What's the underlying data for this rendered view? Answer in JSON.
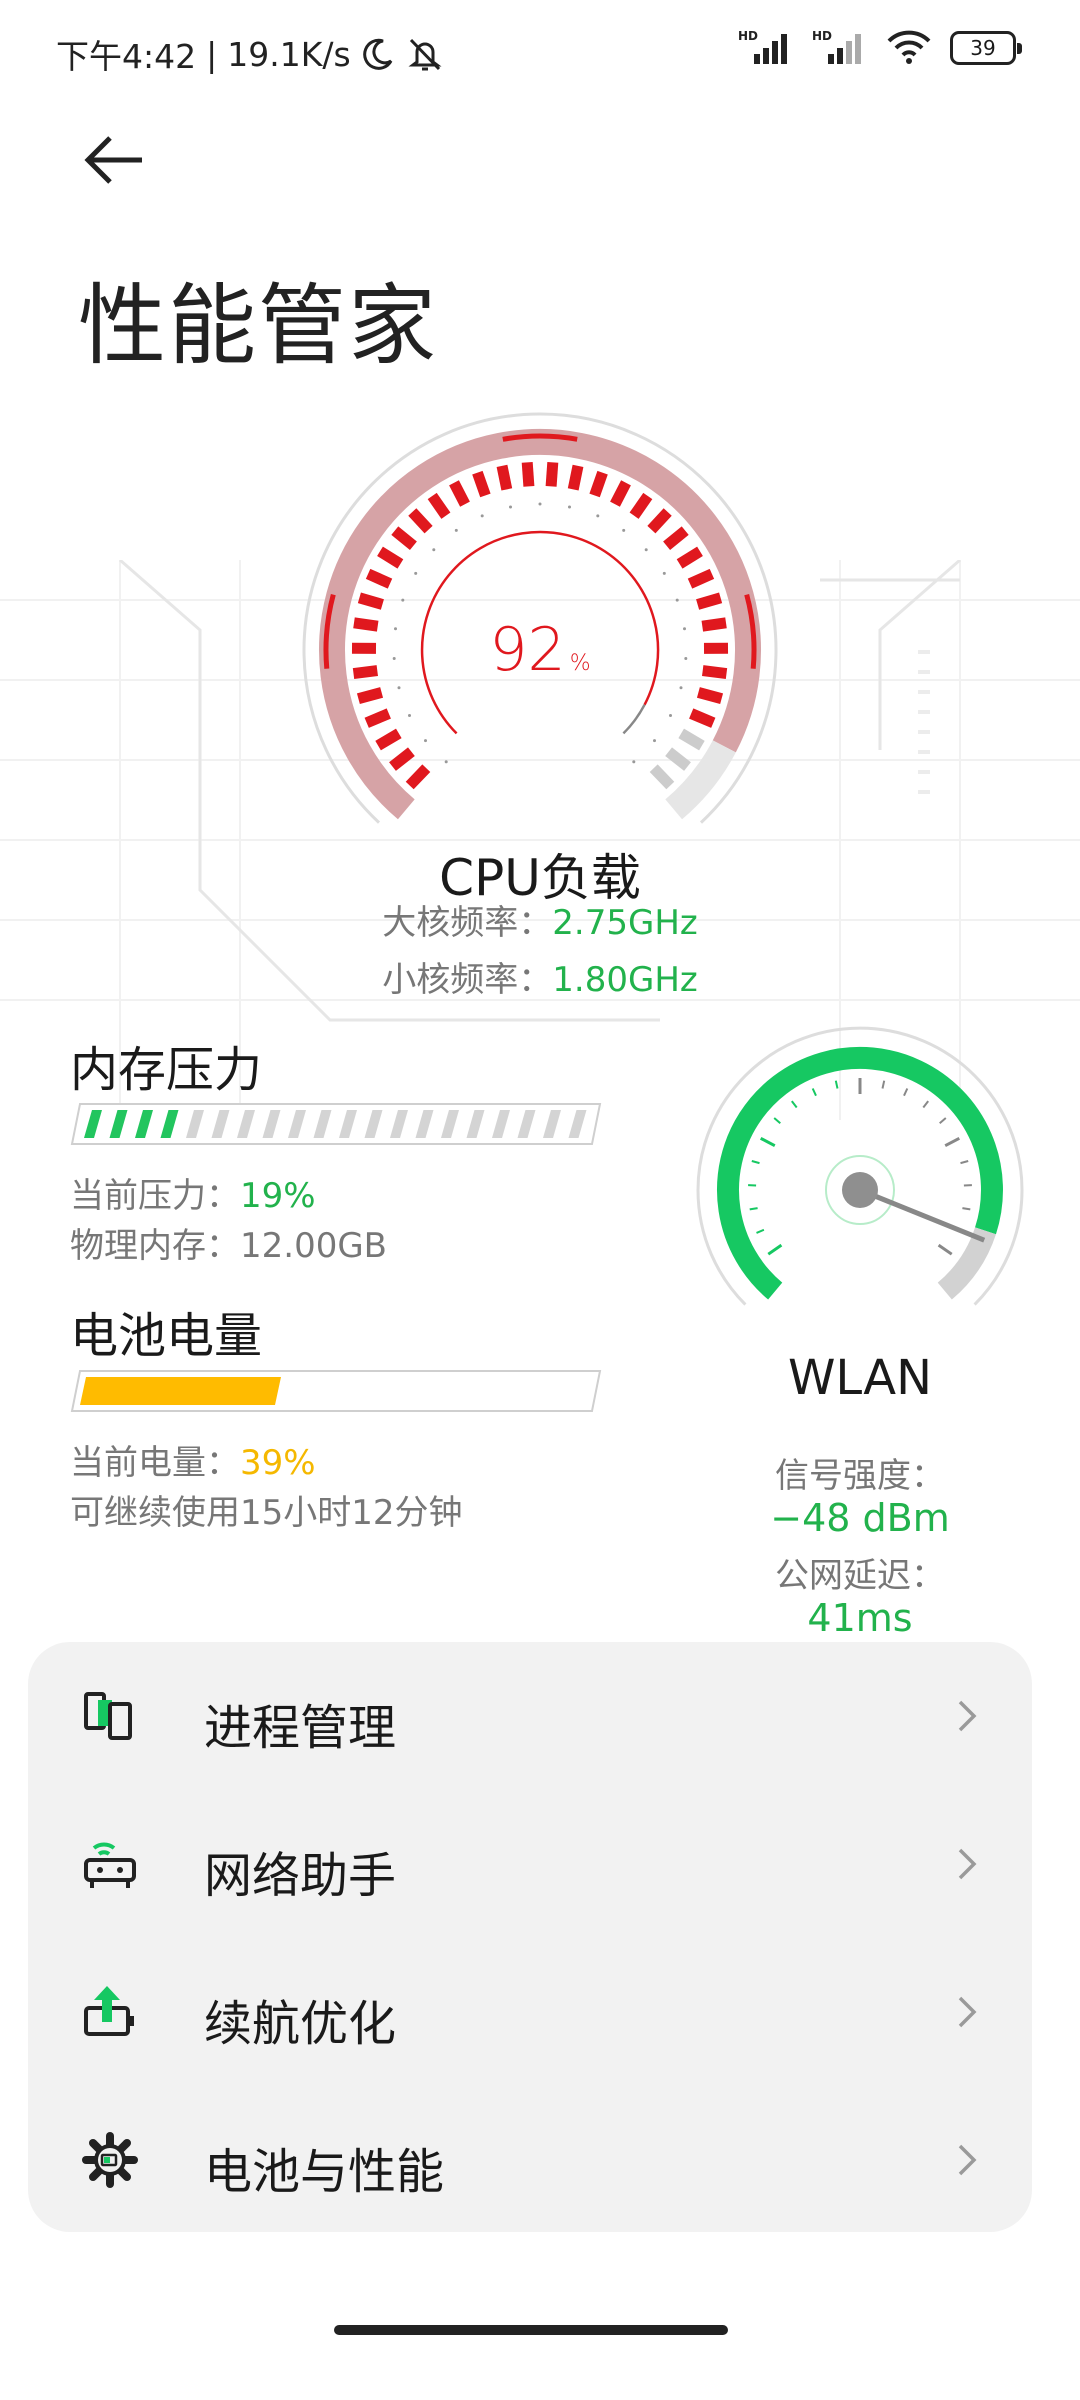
{
  "status_bar": {
    "time": "下午4:42",
    "net_speed": "19.1K/s",
    "hd1": "HD",
    "hd2": "HD",
    "battery": "39",
    "icons": [
      "moon-icon",
      "bell-off-icon",
      "signal-icon",
      "signal-icon",
      "wifi-icon",
      "battery-icon"
    ]
  },
  "header": {
    "back_icon": "arrow-left-icon",
    "title": "性能管家"
  },
  "cpu": {
    "load_value": "92",
    "load_unit": "%",
    "load_fraction": 0.92,
    "label": "CPU负载",
    "big_core_label": "大核频率：",
    "big_core_value": "2.75GHz",
    "small_core_label": "小核频率：",
    "small_core_value": "1.80GHz",
    "color": "#e0181e"
  },
  "memory": {
    "title": "内存压力",
    "pressure_label": "当前压力：",
    "pressure_value": "19%",
    "pressure_fraction": 0.19,
    "physical_label": "物理内存：",
    "physical_value": "12.00GB",
    "color": "#22c55e"
  },
  "battery": {
    "title": "电池电量",
    "level_label": "当前电量：",
    "level_value": "39%",
    "level_fraction": 0.39,
    "remaining_text": "可继续使用15小时12分钟",
    "color": "#ffbb00"
  },
  "wlan": {
    "label": "WLAN",
    "signal_label": "信号强度：",
    "signal_value": "−48 dBm",
    "latency_label": "公网延迟：",
    "latency_value": "41ms",
    "color": "#16c862"
  },
  "menu": {
    "items": [
      {
        "label": "进程管理",
        "icon": "process-icon"
      },
      {
        "label": "网络助手",
        "icon": "router-icon"
      },
      {
        "label": "续航优化",
        "icon": "battery-boost-icon"
      },
      {
        "label": "电池与性能",
        "icon": "gear-icon"
      }
    ],
    "chevron_icon": "chevron-right-icon"
  }
}
